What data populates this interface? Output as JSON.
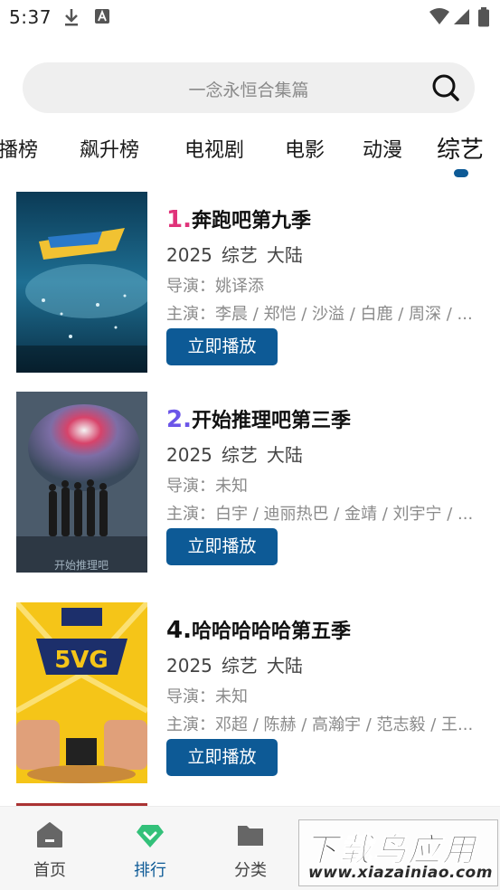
{
  "status_bar": {
    "time": "5:37"
  },
  "search": {
    "placeholder": "一念永恒合集篇"
  },
  "tabs": [
    {
      "label": "播榜"
    },
    {
      "label": "飙升榜"
    },
    {
      "label": "电视剧"
    },
    {
      "label": "电影"
    },
    {
      "label": "动漫"
    },
    {
      "label": "综艺",
      "active": true
    }
  ],
  "items": [
    {
      "rank": "1.",
      "rank_color": "#e0337a",
      "title": "奔跑吧第九季",
      "year": "2025",
      "genre": "综艺",
      "region": "大陆",
      "director": "导演：姚译添",
      "cast": "主演：李晨 / 郑恺 / 沙溢 / 白鹿 / 周深 / ...",
      "play_label": "立即播放"
    },
    {
      "rank": "2.",
      "rank_color": "#6b55e8",
      "title": "开始推理吧第三季",
      "year": "2025",
      "genre": "综艺",
      "region": "大陆",
      "director": "导演：未知",
      "cast": "主演：白宇 / 迪丽热巴 / 金靖 / 刘宇宁 / ...",
      "play_label": "立即播放",
      "poster_caption": "开始推理吧"
    },
    {
      "rank": "4.",
      "rank_color": "#111111",
      "title": "哈哈哈哈哈第五季",
      "year": "2025",
      "genre": "综艺",
      "region": "大陆",
      "director": "导演：未知",
      "cast": "主演：邓超 / 陈赫 / 高瀚宇 / 范志毅 / 王...",
      "play_label": "立即播放",
      "poster_caption": "5VG"
    }
  ],
  "bottom_nav": [
    {
      "label": "首页",
      "icon": "home-icon"
    },
    {
      "label": "排行",
      "icon": "ranking-icon",
      "active": true
    },
    {
      "label": "分类",
      "icon": "folder-icon"
    }
  ],
  "watermark": {
    "main": "下载鸟应用",
    "url": "www.xiazainiao.com"
  },
  "colors": {
    "accent": "#0d5a96",
    "active_tab_indicator": "#0d5a96",
    "ranking_icon": "#33c17a"
  }
}
